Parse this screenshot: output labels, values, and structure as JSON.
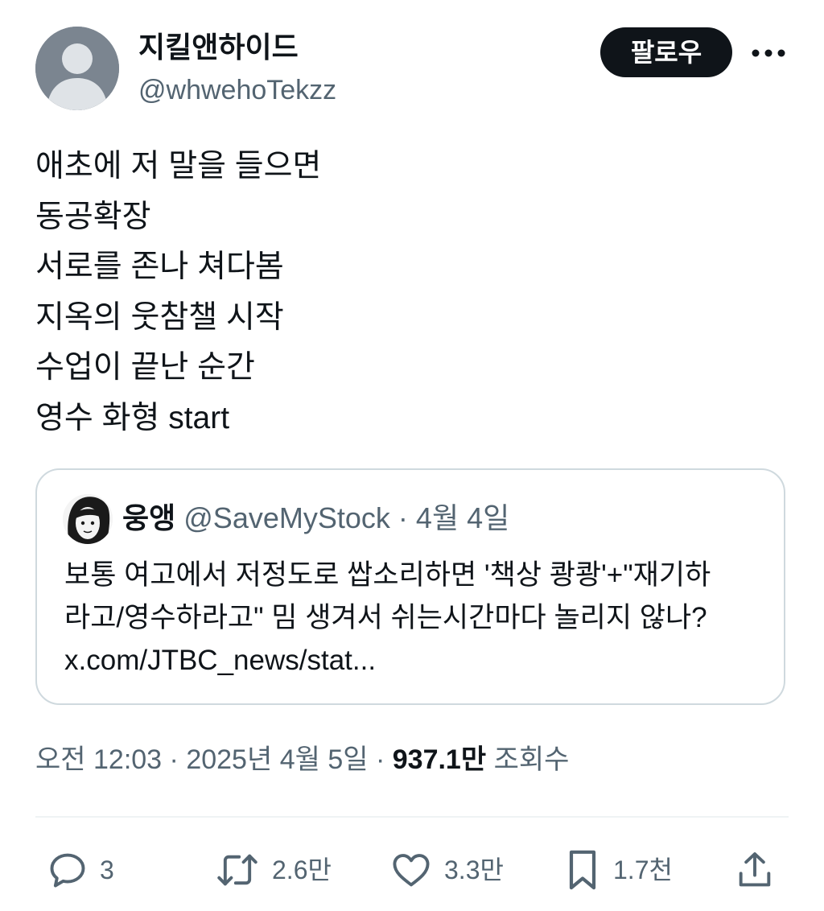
{
  "author": {
    "display_name": "지킬앤하이드",
    "handle": "@whwehoTekzz"
  },
  "follow_label": "팔로우",
  "tweet_lines": [
    "애초에 저 말을 들으면",
    "동공확장",
    "서로를 존나 쳐다봄",
    "지옥의 웃참챌 시작",
    "수업이 끝난 순간",
    "영수 화형 start"
  ],
  "quote": {
    "name": "웅앵",
    "handle": "@SaveMyStock",
    "separator": "·",
    "date": "4월 4일",
    "lines": [
      "보통 여고에서 저정도로 쌉소리하면 '책상 쾅쾅'+\"재기하",
      "라고/영수하라고\" 밈 생겨서 쉬는시간마다 놀리지 않나?",
      "x.com/JTBC_news/stat..."
    ]
  },
  "meta": {
    "time": "오전 12:03",
    "separator": "·",
    "date": "2025년 4월 5일",
    "views_count": "937.1만",
    "views_label": "조회수"
  },
  "actions": {
    "reply": {
      "icon": "reply-icon",
      "count": "3"
    },
    "retweet": {
      "icon": "retweet-icon",
      "count": "2.6만"
    },
    "like": {
      "icon": "heart-icon",
      "count": "3.3만"
    },
    "bookmark": {
      "icon": "bookmark-icon",
      "count": "1.7천"
    },
    "share": {
      "icon": "share-icon"
    }
  },
  "colors": {
    "text_primary": "#0f1419",
    "text_secondary": "#536471",
    "border": "#cfd9de",
    "follow_button_bg": "#0f1419"
  }
}
